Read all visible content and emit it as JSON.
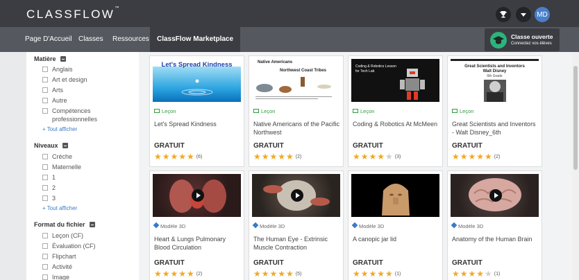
{
  "header": {
    "logo": "CLASSFLOW",
    "logo_tm": "™",
    "avatar_initials": "MD",
    "icons": [
      "trophy-icon",
      "caret-down-icon"
    ]
  },
  "nav": {
    "items": [
      {
        "label": "Page D'Accueil"
      },
      {
        "label": "Classes"
      },
      {
        "label": "Ressources"
      },
      {
        "label": "ClassFlow Marketplace",
        "active": true
      }
    ],
    "classe": {
      "title": "Classe ouverte",
      "subtitle": "Connectez vos élèves"
    }
  },
  "filters": [
    {
      "title": "Matière",
      "items": [
        "Anglais",
        "Art et design",
        "Arts",
        "Autre",
        "Compétences professionnelles"
      ],
      "more": "+ Tout afficher"
    },
    {
      "title": "Niveaux",
      "items": [
        "Crèche",
        "Maternelle",
        "1",
        "2",
        "3"
      ],
      "more": "+ Tout afficher"
    },
    {
      "title": "Format du fichier",
      "items": [
        "Leçon (CF)",
        "Évaluation (CF)",
        "Flipchart",
        "Activité",
        "Image"
      ]
    }
  ],
  "cards": [
    {
      "type": "Leçon",
      "title": "Let's Spread Kindness",
      "price": "GRATUIT",
      "rating": 5,
      "count": "(6)",
      "thumb_text": "Let's Spread Kindness"
    },
    {
      "type": "Leçon",
      "title": "Native Americans of the Pacific Northwest",
      "price": "GRATUIT",
      "rating": 5,
      "count": "(2)",
      "thumb_text": "Native Americans",
      "thumb_text2": "Northwest Coast Tribes"
    },
    {
      "type": "Leçon",
      "title": "Coding & Robotics At McMeen",
      "price": "GRATUIT",
      "rating": 4,
      "count": "(3)",
      "thumb_text": "Coding & Robotics Lesson",
      "thumb_text2": "for Tech Lab"
    },
    {
      "type": "Leçon",
      "title": "Great Scientists and Inventors - Walt Disney_6th",
      "price": "GRATUIT",
      "rating": 5,
      "count": "(2)",
      "thumb_text": "Great Scientists and Inventors",
      "thumb_text2": "Walt Disney",
      "thumb_text3": "6th Grade"
    },
    {
      "type": "Modèle 3D",
      "title": "Heart & Lungs Pulmonary Blood Circulation",
      "price": "GRATUIT",
      "rating": 5,
      "count": "(2)"
    },
    {
      "type": "Modèle 3D",
      "title": "The Human Eye - Extrinsic Muscle Contraction",
      "price": "GRATUIT",
      "rating": 5,
      "count": "(5)"
    },
    {
      "type": "Modèle 3D",
      "title": "A canopic jar lid",
      "price": "GRATUIT",
      "rating": 5,
      "count": "(1)"
    },
    {
      "type": "Modèle 3D",
      "title": "Anatomy of the Human Brain",
      "price": "GRATUIT",
      "rating": 4,
      "count": "(1)"
    }
  ],
  "colors": {
    "topbar": "#3b3d42",
    "navbar": "#55585e",
    "accent_green": "#2db37c",
    "star": "#f0a824",
    "link": "#3a7bc8"
  }
}
